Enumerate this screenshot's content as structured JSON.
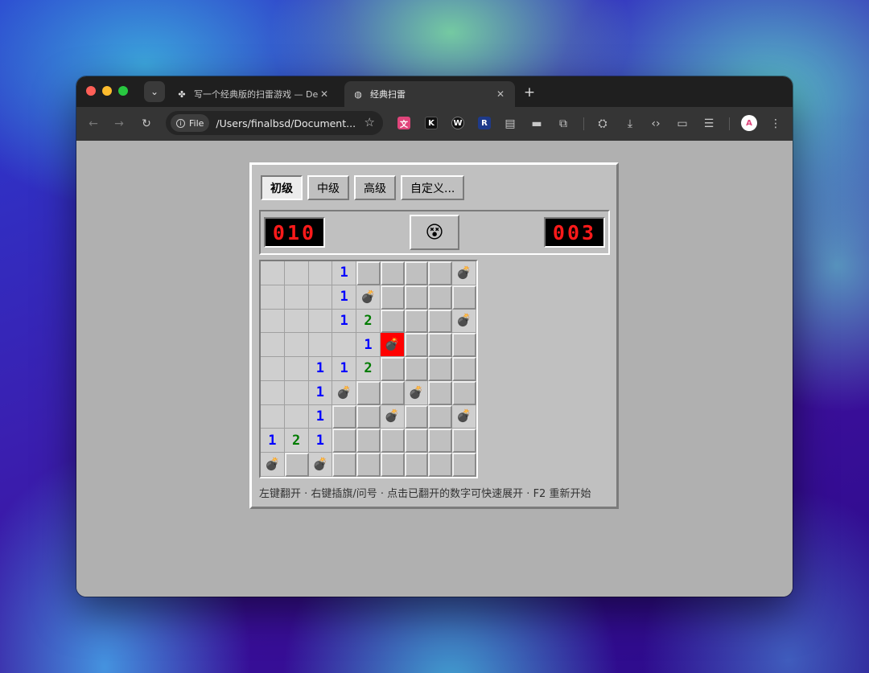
{
  "browser": {
    "tabs": [
      {
        "title": "写一个经典版的扫雷游戏 — De",
        "active": false,
        "icon": "app-logo-icon"
      },
      {
        "title": "经典扫雷",
        "active": true,
        "icon": "globe-icon"
      }
    ],
    "new_tab_label": "+",
    "omnibox": {
      "scheme_label": "File",
      "url": "/Users/finalbsd/Document..."
    },
    "extensions": [
      {
        "label": "文",
        "color": "#e0457b"
      },
      {
        "label": "K",
        "color": "#111111"
      },
      {
        "label": "W",
        "color": "#111111"
      },
      {
        "label": "R",
        "color": "#1e3a8a"
      }
    ]
  },
  "game": {
    "levels": [
      "初级",
      "中级",
      "高级",
      "自定义..."
    ],
    "active_level": 0,
    "mine_counter": "010",
    "timer": "003",
    "face": "😵",
    "board": [
      [
        "o",
        "o",
        "o",
        "1",
        "c",
        "c",
        "c",
        "c",
        "m"
      ],
      [
        "o",
        "o",
        "o",
        "1",
        "m",
        "c",
        "c",
        "c",
        "c"
      ],
      [
        "o",
        "o",
        "o",
        "1",
        "2",
        "c",
        "c",
        "c",
        "m"
      ],
      [
        "o",
        "o",
        "o",
        "o",
        "1",
        "x",
        "c",
        "c",
        "c"
      ],
      [
        "o",
        "o",
        "1",
        "1",
        "2",
        "c",
        "c",
        "c",
        "c"
      ],
      [
        "o",
        "o",
        "1",
        "m",
        "c",
        "c",
        "m",
        "c",
        "c"
      ],
      [
        "o",
        "o",
        "1",
        "c",
        "c",
        "m",
        "c",
        "c",
        "m"
      ],
      [
        "1",
        "2",
        "1",
        "c",
        "c",
        "c",
        "c",
        "c",
        "c"
      ],
      [
        "m",
        "c",
        "m",
        "c",
        "c",
        "c",
        "c",
        "c",
        "c"
      ]
    ],
    "hint": "左键翻开 · 右键插旗/问号 · 点击已翻开的数字可快速展开 · F2 重新开始"
  }
}
